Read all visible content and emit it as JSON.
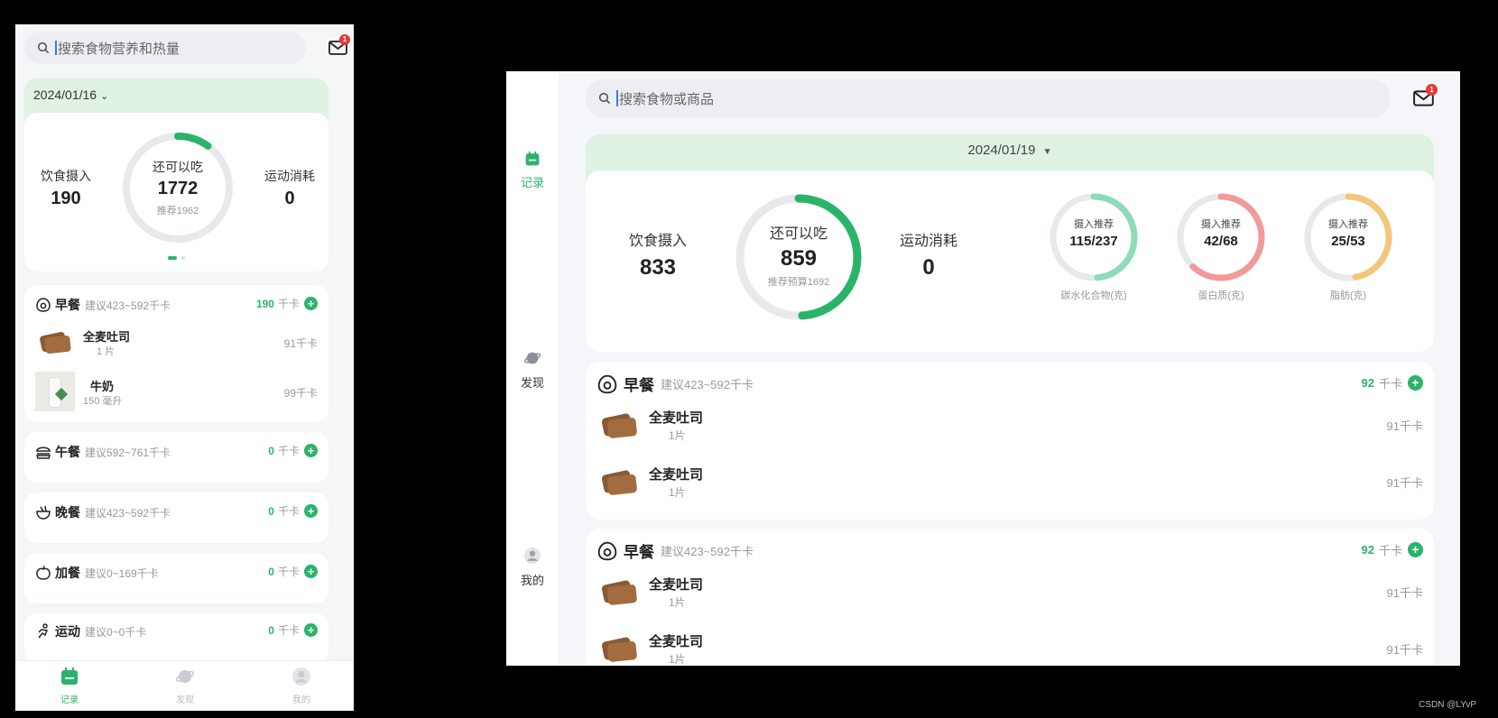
{
  "phone": {
    "search_placeholder": "搜索食物营养和热量",
    "mail_badge": "1",
    "date": "2024/01/16",
    "intake_label": "饮食摄入",
    "intake_value": "190",
    "remaining_label": "还可以吃",
    "remaining_value": "1772",
    "recommend_text": "推荐1962",
    "exercise_label": "运动消耗",
    "exercise_value": "0",
    "remaining_progress": 0.1,
    "meals": [
      {
        "name": "早餐",
        "suggest": "建议423~592千卡",
        "kcal": "190",
        "unit": "千卡",
        "items": [
          {
            "name": "全麦吐司",
            "amount": "1 片",
            "kcal": "91千卡"
          },
          {
            "name": "牛奶",
            "amount": "150 毫升",
            "kcal": "99千卡"
          }
        ]
      },
      {
        "name": "午餐",
        "suggest": "建议592~761千卡",
        "kcal": "0",
        "unit": "千卡"
      },
      {
        "name": "晚餐",
        "suggest": "建议423~592千卡",
        "kcal": "0",
        "unit": "千卡"
      },
      {
        "name": "加餐",
        "suggest": "建议0~169千卡",
        "kcal": "0",
        "unit": "千卡"
      },
      {
        "name": "运动",
        "suggest": "建议0~0千卡",
        "kcal": "0",
        "unit": "千卡"
      }
    ],
    "tabs": [
      {
        "label": "记录",
        "icon": "calendar-icon"
      },
      {
        "label": "发现",
        "icon": "planet-icon"
      },
      {
        "label": "我的",
        "icon": "user-icon"
      }
    ]
  },
  "tablet": {
    "search_placeholder": "搜索食物或商品",
    "mail_badge": "1",
    "date": "2024/01/19",
    "intake_label": "饮食摄入",
    "intake_value": "833",
    "remaining_label": "还可以吃",
    "remaining_value": "859",
    "recommend_text": "推荐预算1692",
    "exercise_label": "运动消耗",
    "exercise_value": "0",
    "remaining_progress": 0.49,
    "macros": [
      {
        "top": "摄入推荐",
        "value": "115/237",
        "label": "碳水化合物(克)",
        "color": "#8ddbb8",
        "progress": 0.485
      },
      {
        "top": "摄入推荐",
        "value": "42/68",
        "label": "蛋白质(克)",
        "color": "#f09a9a",
        "progress": 0.62
      },
      {
        "top": "摄入推荐",
        "value": "25/53",
        "label": "脂肪(克)",
        "color": "#f4c67a",
        "progress": 0.47
      }
    ],
    "sidebar": [
      {
        "label": "记录",
        "icon": "calendar-icon"
      },
      {
        "label": "发现",
        "icon": "planet-icon"
      },
      {
        "label": "我的",
        "icon": "user-icon"
      }
    ],
    "meals": [
      {
        "name": "早餐",
        "suggest": "建议423~592千卡",
        "kcal": "92",
        "unit": "千卡",
        "items": [
          {
            "name": "全麦吐司",
            "amount": "1片",
            "kcal": "91千卡"
          },
          {
            "name": "全麦吐司",
            "amount": "1片",
            "kcal": "91千卡"
          }
        ]
      },
      {
        "name": "早餐",
        "suggest": "建议423~592千卡",
        "kcal": "92",
        "unit": "千卡",
        "items": [
          {
            "name": "全麦吐司",
            "amount": "1片",
            "kcal": "91千卡"
          },
          {
            "name": "全麦吐司",
            "amount": "1片",
            "kcal": "91千卡"
          }
        ]
      }
    ]
  },
  "watermark": "CSDN @LYvP",
  "colors": {
    "accent": "#2ab46a",
    "header_bg": "#dff2e4",
    "ring_bg": "#e8e9ec"
  }
}
